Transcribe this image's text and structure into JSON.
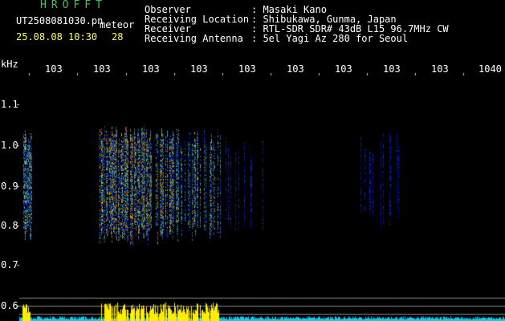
{
  "header": {
    "brand": "HROFFT",
    "filename": "UT2508081030.pn",
    "meteor_label": "meteor",
    "datetime": "25.08.08 10:30",
    "meteor_count": "28",
    "fields": [
      {
        "label": "Observer",
        "value": ": Masaki Kano"
      },
      {
        "label": "Receiving Location",
        "value": ": Shibukawa, Gunma, Japan"
      },
      {
        "label": "Receiver",
        "value": ": RTL-SDR SDR# 43dB L15 96.7MHz CW"
      },
      {
        "label": "Receiving Antenna",
        "value": ": 5el Yagi Az 280 for Seoul"
      }
    ]
  },
  "axes": {
    "y_unit": "kHz",
    "x_ticks": [
      "103",
      "103",
      "103",
      "103",
      "103",
      "103",
      "103",
      "103",
      "103",
      "1040"
    ],
    "y_ticks": [
      "1.1",
      "1.0",
      "0.9",
      "0.8",
      "0.7",
      "0.6"
    ]
  },
  "colors": {
    "background": "#000000",
    "header_text": "#ffffff",
    "highlight_text": "#ffff55",
    "brand": "#3cc850",
    "grid_line": "#8a8a8a",
    "meter_cyan": "#1ac8e6",
    "meter_yellow": "#ffee00"
  }
}
